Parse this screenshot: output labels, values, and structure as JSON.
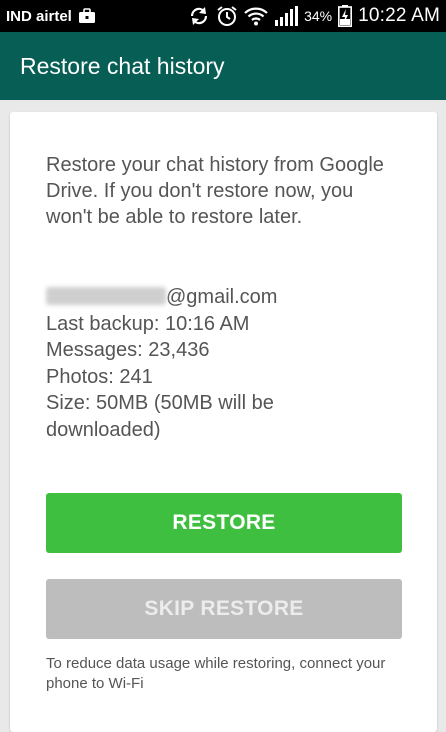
{
  "status_bar": {
    "carrier": "IND airtel",
    "battery_percent": "34%",
    "time": "10:22 AM",
    "icons": [
      "briefcase-icon",
      "sync-icon",
      "alarm-icon",
      "wifi-icon",
      "signal-icon",
      "battery-charging-icon"
    ]
  },
  "app_bar": {
    "title": "Restore chat history",
    "color": "#075e54"
  },
  "content": {
    "description": "Restore your chat history from Google Drive. If you don't restore now, you won't be able to restore later.",
    "account_suffix": "@gmail.com",
    "last_backup": "Last backup: 10:16 AM",
    "messages": "Messages: 23,436",
    "photos": "Photos: 241",
    "size": "Size: 50MB (50MB will be downloaded)"
  },
  "buttons": {
    "restore_label": "RESTORE",
    "restore_color": "#3fbf3f",
    "skip_label": "SKIP RESTORE",
    "skip_color": "#bdbdbd"
  },
  "footnote": "To reduce data usage while restoring, connect your phone to Wi-Fi"
}
